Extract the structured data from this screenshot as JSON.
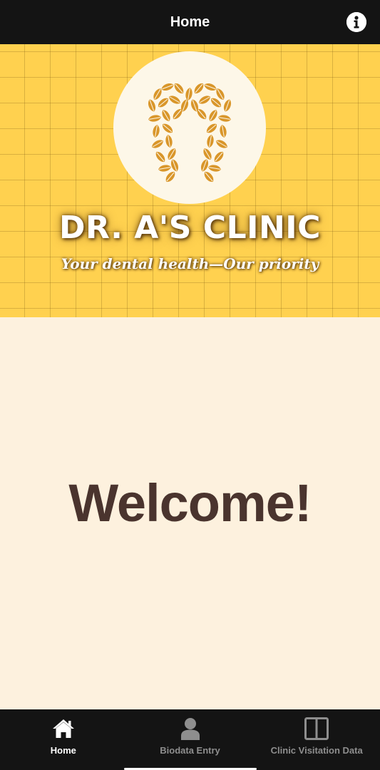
{
  "header": {
    "title": "Home",
    "info_icon": "info-icon"
  },
  "banner": {
    "logo_icon": "tooth-leaves-logo",
    "clinic_name": "DR. A'S CLINIC",
    "tagline": "Your dental health—Our priority"
  },
  "main": {
    "welcome_text": "Welcome!"
  },
  "tabs": [
    {
      "label": "Home",
      "icon": "home-icon",
      "active": true
    },
    {
      "label": "Biodata Entry",
      "icon": "person-icon",
      "active": false
    },
    {
      "label": "Clinic Visitation Data",
      "icon": "split-panel-icon",
      "active": false
    }
  ],
  "colors": {
    "header_bg": "#141414",
    "banner_yellow": "#ffd14f",
    "page_bg": "#fdf1de",
    "welcome_text": "#4a342e",
    "tab_active": "#ffffff",
    "tab_inactive": "#8e8e8e",
    "leaf_gold": "#d9962a"
  }
}
